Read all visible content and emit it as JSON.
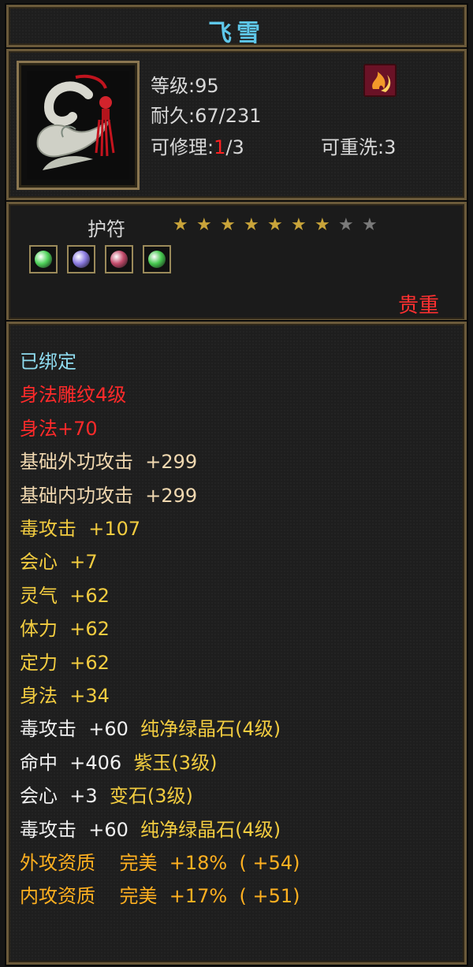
{
  "title": "飞雪",
  "item": {
    "level_label": "等级",
    "level_value": ":95",
    "durability_label": "耐久",
    "durability_value": ":67/231",
    "repair_label": "可修理",
    "repair_colon": ":",
    "repair_current": "1",
    "repair_max": "/3",
    "rewash_label": "可重洗",
    "rewash_value": ":3",
    "image_icon": "jade-pendant-icon",
    "skill_icon": "flame-skill-icon"
  },
  "type": {
    "label": "护符",
    "stars_filled": 7,
    "stars_total": 9,
    "star_colors": {
      "filled": "#c9a43a",
      "empty": "#7a7a7a"
    }
  },
  "gems": [
    {
      "icon": "green-gem-icon",
      "color": "#4fd35a"
    },
    {
      "icon": "purple-gem-icon",
      "color": "#8a7ae0"
    },
    {
      "icon": "red-gem-icon",
      "color": "#c24a6a"
    },
    {
      "icon": "green-gem-icon",
      "color": "#46c84f"
    }
  ],
  "rarity": "贵重",
  "attributes": [
    {
      "text": "已绑定",
      "color": "cyan"
    },
    {
      "text": "身法雕纹4级",
      "color": "red"
    },
    {
      "text": "身法+70",
      "color": "red"
    },
    {
      "text": "基础外功攻击  +299",
      "color": "light"
    },
    {
      "text": "基础内功攻击  +299",
      "color": "light"
    },
    {
      "text": "毒攻击  +107",
      "color": "yellow"
    },
    {
      "text": "会心  +7",
      "color": "yellow"
    },
    {
      "text": "灵气  +62",
      "color": "yellow"
    },
    {
      "text": "体力  +62",
      "color": "yellow"
    },
    {
      "text": "定力  +62",
      "color": "yellow"
    },
    {
      "text": "身法  +34",
      "color": "yellow"
    },
    {
      "prefix": "毒攻击  +60  ",
      "suffix": "纯净绿晶石(4级)",
      "color": "white"
    },
    {
      "prefix": "命中  +406  ",
      "suffix": "紫玉(3级)",
      "color": "white"
    },
    {
      "prefix": "会心  +3  ",
      "suffix": "变石(3级)",
      "color": "white"
    },
    {
      "prefix": "毒攻击  +60  ",
      "suffix": "纯净绿晶石(4级)",
      "color": "white"
    },
    {
      "text": "外攻资质    完美  +18%  ( +54)",
      "color": "orange"
    },
    {
      "text": "内攻资质    完美  +17%  ( +51)",
      "color": "orange"
    }
  ]
}
